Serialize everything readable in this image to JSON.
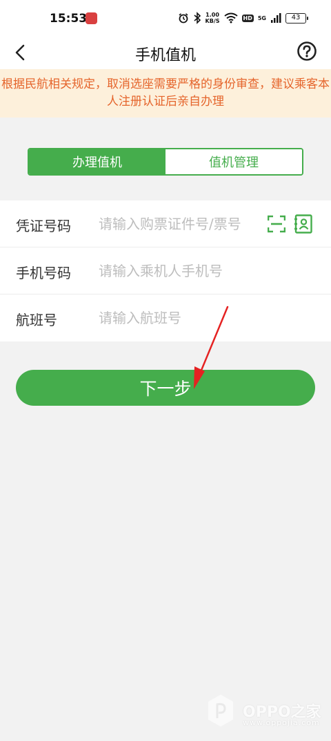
{
  "status_bar": {
    "time": "15:53",
    "network_speed": "1.00",
    "network_unit": "KB/S",
    "hd_label": "HD",
    "signal_label": "5G",
    "battery": "43"
  },
  "nav": {
    "title": "手机值机",
    "back_icon": "chevron-left-icon",
    "help_icon": "question-circle-icon"
  },
  "notice": {
    "text": "根据民航相关规定，取消选座需要严格的身份审查，建议乘客本人注册认证后亲自办理"
  },
  "tabs": [
    {
      "label": "办理值机",
      "active": true
    },
    {
      "label": "值机管理",
      "active": false
    }
  ],
  "form": {
    "ticket": {
      "label": "凭证号码",
      "placeholder": "请输入购票证件号/票号",
      "value": ""
    },
    "phone": {
      "label": "手机号码",
      "placeholder": "请输入乘机人手机号",
      "value": ""
    },
    "flight": {
      "label": "航班号",
      "placeholder": "请输入航班号",
      "value": ""
    }
  },
  "next_button": {
    "label": "下一步"
  },
  "watermark": {
    "brand": "OPPO之家",
    "url": "www.oppojia.com"
  },
  "colors": {
    "accent": "#45ad4c",
    "notice_bg": "#fdf0db",
    "notice_text": "#e5642b",
    "annotation_arrow": "#e52222"
  }
}
